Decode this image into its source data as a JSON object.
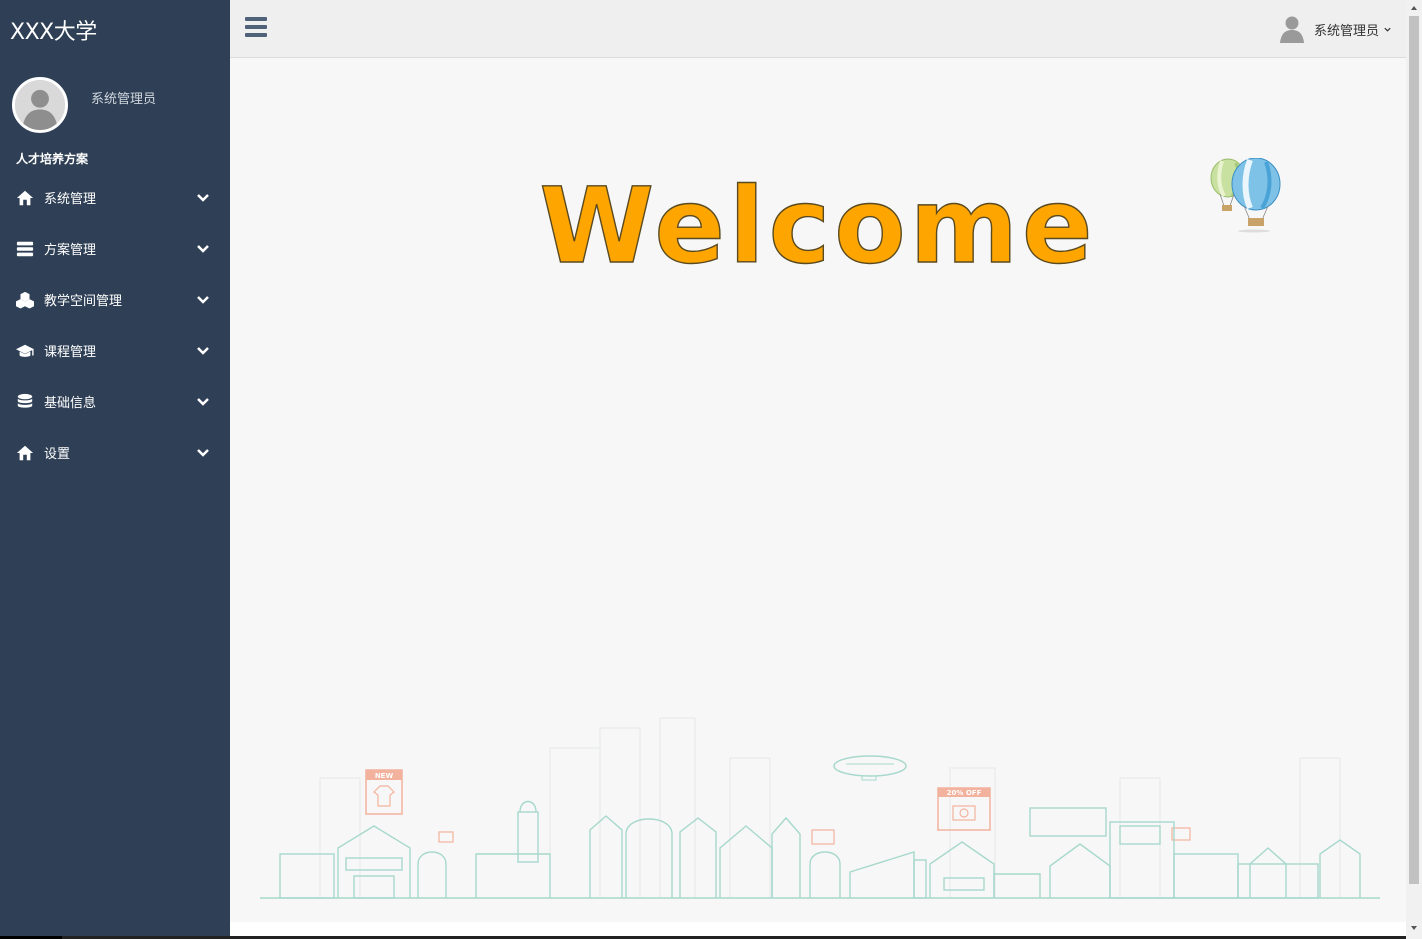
{
  "brand": {
    "title": "XXX大学"
  },
  "profile": {
    "name": "系统管理员"
  },
  "sidebar": {
    "section_title": "人才培养方案",
    "items": [
      {
        "label": "系统管理",
        "icon": "home-icon"
      },
      {
        "label": "方案管理",
        "icon": "list-icon"
      },
      {
        "label": "教学空间管理",
        "icon": "cubes-icon"
      },
      {
        "label": "课程管理",
        "icon": "graduation-cap-icon"
      },
      {
        "label": "基础信息",
        "icon": "database-icon"
      },
      {
        "label": "设置",
        "icon": "home-icon"
      }
    ]
  },
  "topbar": {
    "user_label": "系统管理员"
  },
  "main": {
    "welcome_text": "Welcome",
    "illustration": {
      "new_tag": "NEW",
      "discount_tag": "20% OFF"
    }
  },
  "colors": {
    "sidebar_bg": "#2f4056",
    "topbar_bg": "#efefef",
    "content_bg": "#f7f7f7",
    "welcome_fill": "#ffa500",
    "hamburger": "#4e6279"
  }
}
